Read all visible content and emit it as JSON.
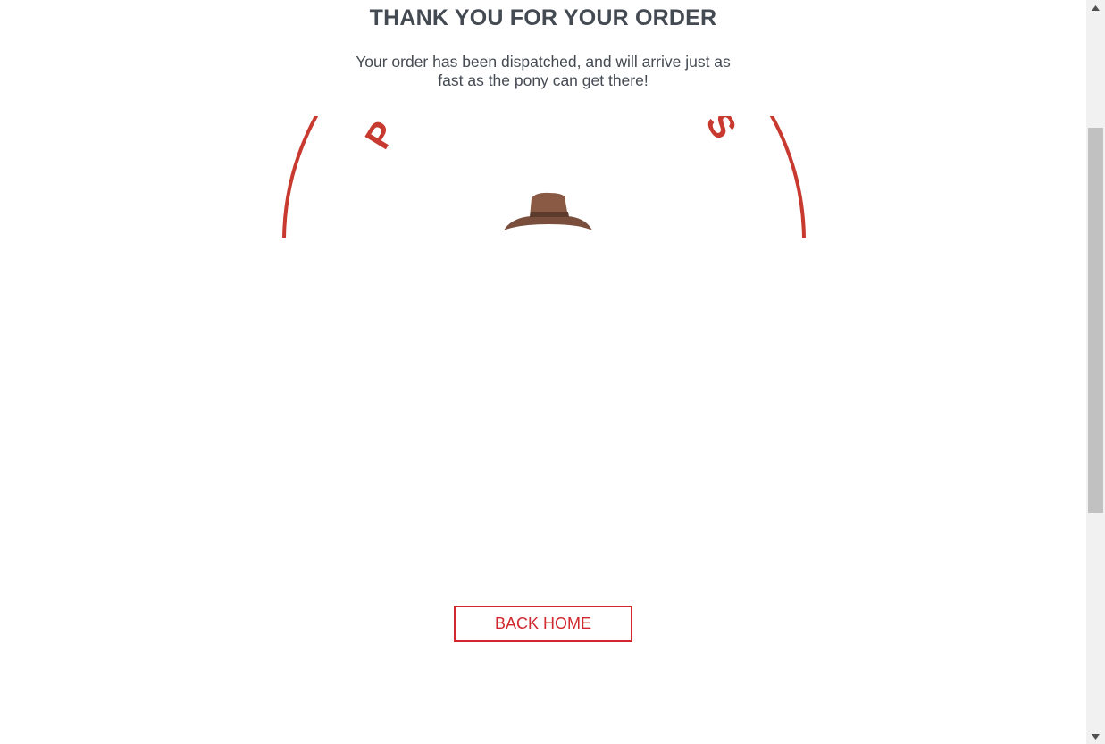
{
  "confirmation": {
    "title": "THANK YOU FOR YOUR ORDER",
    "message": "Your order has been dispatched, and will arrive just as fast as the pony can get there!"
  },
  "logo": {
    "text": "PONY EXPRESS",
    "icon": "cowboy-hat-logo",
    "colors": {
      "brand_red": "#c8392f",
      "hat_brown": "#8a5a45",
      "hat_band": "#5c3a2c",
      "bandana_red": "#d9302b",
      "bandana_blue": "#3b9be0"
    }
  },
  "actions": {
    "back_home_label": "BACK HOME"
  },
  "colors": {
    "text": "#444a52",
    "accent": "#d0282e"
  },
  "scrollbar": {
    "up_icon": "triangle-up-icon",
    "down_icon": "triangle-down-icon"
  }
}
